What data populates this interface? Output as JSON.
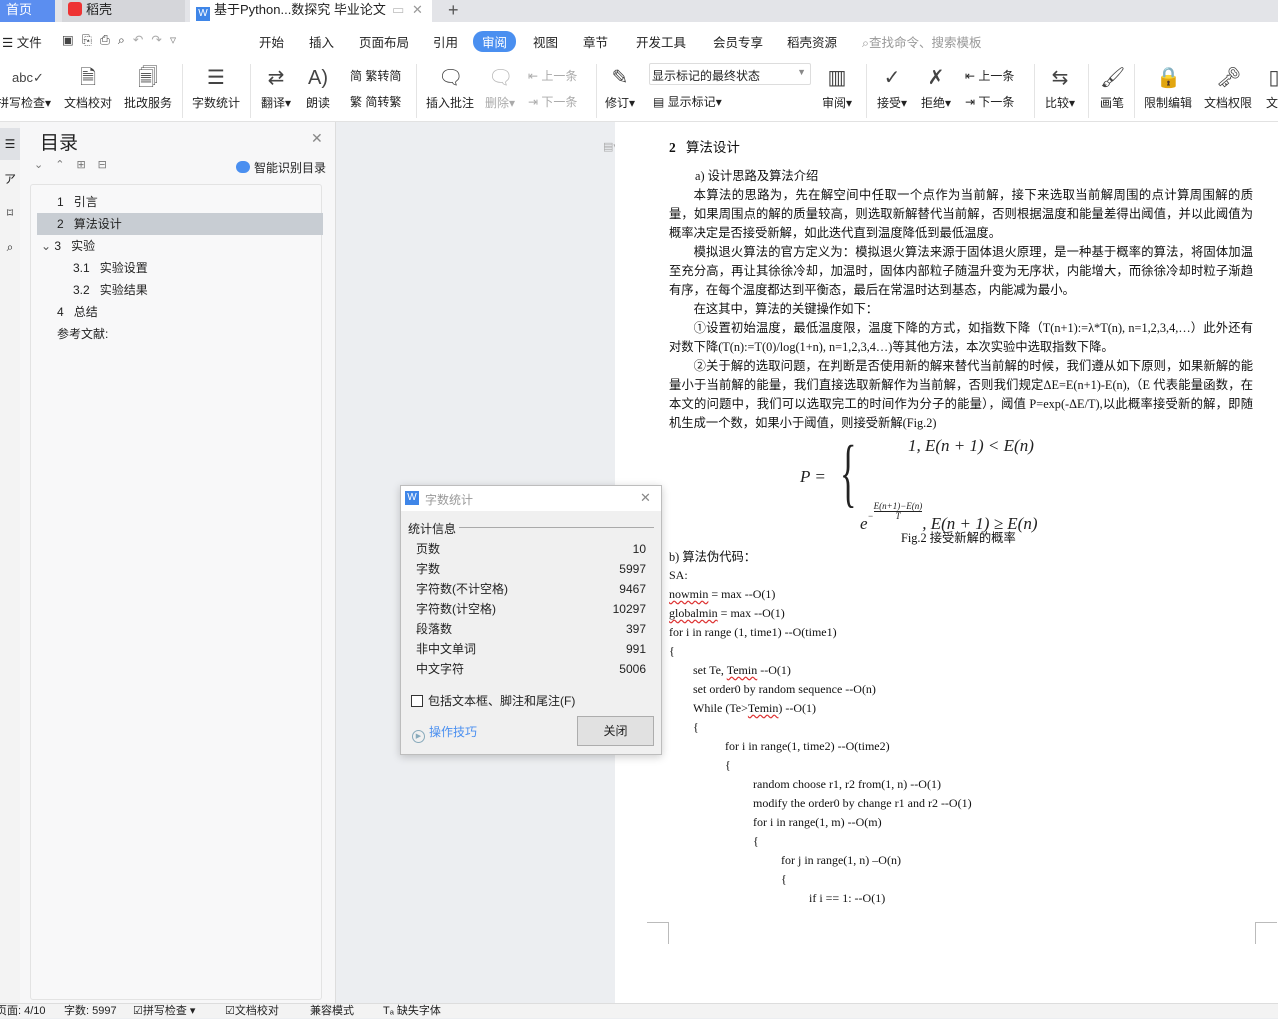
{
  "tabs": [
    {
      "label": "首页"
    },
    {
      "label": "稻壳"
    },
    {
      "label": "基于Python...数探究 毕业论文"
    }
  ],
  "menu": {
    "file": "文件",
    "items": [
      "开始",
      "插入",
      "页面布局",
      "引用",
      "审阅",
      "视图",
      "章节",
      "开发工具",
      "会员专享",
      "稻壳资源"
    ],
    "active": "审阅",
    "search_placeholder": "查找命令、搜索模板"
  },
  "ribbon": {
    "spell": "拼写检查",
    "proof": "文档校对",
    "correct": "批改服务",
    "wordcount": "字数统计",
    "translate": "翻译",
    "read": "朗读",
    "t2s": "繁转简",
    "s2t": "简转繁",
    "insert_comment": "插入批注",
    "delete": "删除",
    "prev_comment": "上一条",
    "next_comment": "下一条",
    "revise": "修订",
    "markup_select": "显示标记的最终状态",
    "show_markup": "显示标记",
    "review": "审阅",
    "accept": "接受",
    "reject": "拒绝",
    "prev": "上一条",
    "next": "下一条",
    "compare": "比较",
    "pen": "画笔",
    "restrict": "限制编辑",
    "permission": "文档权限",
    "more": "文"
  },
  "nav": {
    "title": "目录",
    "smart": "智能识别目录",
    "items": [
      {
        "num": "1",
        "label": "引言"
      },
      {
        "num": "2",
        "label": "算法设计"
      },
      {
        "num": "3",
        "label": "实验"
      },
      {
        "num": "3.1",
        "label": "实验设置"
      },
      {
        "num": "3.2",
        "label": "实验结果"
      },
      {
        "num": "4",
        "label": "总结"
      },
      {
        "num": "",
        "label": "参考文献:"
      }
    ],
    "selected": "算法设计"
  },
  "doc": {
    "heading_num": "2",
    "heading": "算法设计",
    "sub_a": "a) 设计思路及算法介绍",
    "p1": "本算法的思路为，先在解空间中任取一个点作为当前解，接下来选取当前解周围的点计算周围解的质量，如果周围点的解的质量较高，则选取新解替代当前解，否则根据温度和能量差得出阈值，并以此阈值为概率决定是否接受新解，如此迭代直到温度降低到最低温度。",
    "p2": "模拟退火算法的官方定义为：模拟退火算法来源于固体退火原理，是一种基于概率的算法，将固体加温至充分高，再让其徐徐冷却，加温时，固体内部粒子随温升变为无序状，内能增大，而徐徐冷却时粒子渐趋有序，在每个温度都达到平衡态，最后在常温时达到基态，内能减为最小。",
    "p3": "在这其中，算法的关键操作如下：",
    "p4": "①设置初始温度，最低温度限，温度下降的方式，如指数下降（T(n+1):=λ*T(n), n=1,2,3,4,…）此外还有对数下降(T(n):=T(0)/log(1+n), n=1,2,3,4…)等其他方法，本次实验中选取指数下降。",
    "p5": "②关于解的选取问题，在判断是否使用新的解来替代当前解的时候，我们遵从如下原则，如果新解的能量小于当前解的能量，我们直接选取新解作为当前解，否则我们规定ΔE=E(n+1)-E(n),（E 代表能量函数，在本文的问题中，我们可以选取完工的时间作为分子的能量），阈值 P=exp(-ΔE/T),以此概率接受新的解，即随机生成一个数，如果小于阈值，则接受新解(Fig.2)",
    "formula": {
      "lhs": "P =",
      "case1": "1, E(n + 1) < E(n)",
      "case2_exp_num": "E(n+1)−E(n)",
      "case2_exp_den": "T",
      "case2_base": "e",
      "case2_cond": ", E(n + 1) ≥ E(n)"
    },
    "caption": "Fig.2  接受新解的概率",
    "sub_b": "b) 算法伪代码：",
    "code": [
      {
        "indent": 0,
        "text": "SA:"
      },
      {
        "indent": 0,
        "sq": "nowmin",
        "text": " = max --O(1)"
      },
      {
        "indent": 0,
        "sq": "globalmin",
        "text": " = max --O(1)"
      },
      {
        "indent": 0,
        "text": "for i in range (1, time1) --O(time1)"
      },
      {
        "indent": 0,
        "text": "{"
      },
      {
        "indent": 1,
        "pre": "set Te, ",
        "sq": "Temin",
        "text": " --O(1)"
      },
      {
        "indent": 1,
        "text": "set order0 by random sequence --O(n)"
      },
      {
        "indent": 1,
        "pre": "While (Te>",
        "sq": "Temin",
        "text": ") --O(1)"
      },
      {
        "indent": 1,
        "text": "{"
      },
      {
        "indent": 2,
        "text": "for i in range(1, time2) --O(time2)"
      },
      {
        "indent": 2,
        "text": "{"
      },
      {
        "indent": 3,
        "text": "random choose r1, r2 from(1, n) --O(1)"
      },
      {
        "indent": 3,
        "text": "modify the order0 by change r1 and r2 --O(1)"
      },
      {
        "indent": 3,
        "text": "for i in range(1, m) --O(m)"
      },
      {
        "indent": 3,
        "text": "{"
      },
      {
        "indent": 4,
        "text": "for j in range(1, n) –O(n)"
      },
      {
        "indent": 4,
        "text": "{"
      },
      {
        "indent": 5,
        "text": "if i == 1: --O(1)"
      }
    ]
  },
  "dialog": {
    "title": "字数统计",
    "group": "统计信息",
    "rows": [
      {
        "label": "页数",
        "value": "10"
      },
      {
        "label": "字数",
        "value": "5997"
      },
      {
        "label": "字符数(不计空格)",
        "value": "9467"
      },
      {
        "label": "字符数(计空格)",
        "value": "10297"
      },
      {
        "label": "段落数",
        "value": "397"
      },
      {
        "label": "非中文单词",
        "value": "991"
      },
      {
        "label": "中文字符",
        "value": "5006"
      }
    ],
    "checkbox": "包括文本框、脚注和尾注(F)",
    "checked": false,
    "tips": "操作技巧",
    "close": "关闭"
  },
  "status": {
    "page": "页面: 4/10",
    "words": "字数: 5997",
    "spell": "拼写检查",
    "proof": "文档校对",
    "compat": "兼容模式",
    "font": "缺失字体"
  },
  "colors": {
    "accent": "#4a8ff0",
    "home_tab": "#5b8ef0",
    "selected_toc": "#c8cdd3",
    "dialog_bg": "#f0f0f0",
    "link": "#4a8ff0"
  }
}
